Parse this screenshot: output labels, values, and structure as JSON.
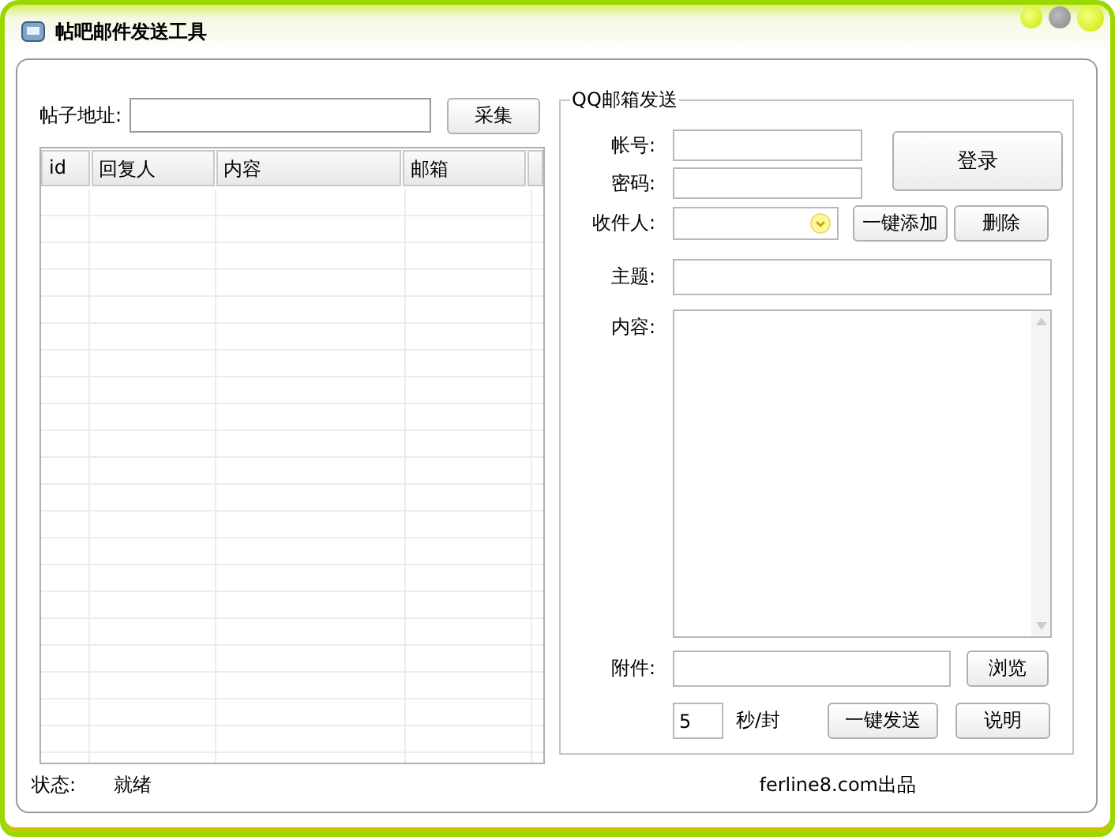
{
  "window": {
    "title": "帖吧邮件发送工具"
  },
  "left": {
    "url_label": "帖子地址:",
    "collect_button": "采集"
  },
  "table": {
    "columns": [
      "id",
      "回复人",
      "内容",
      "邮箱"
    ]
  },
  "send_group": {
    "title": "QQ邮箱发送",
    "account_label": "帐号:",
    "password_label": "密码:",
    "login_button": "登录",
    "recipient_label": "收件人:",
    "add_all_button": "一键添加",
    "delete_button": "删除",
    "subject_label": "主题:",
    "content_label": "内容:",
    "attachment_label": "附件:",
    "browse_button": "浏览",
    "interval_value": "5",
    "interval_unit": "秒/封",
    "send_all_button": "一键发送",
    "help_button": "说明"
  },
  "status_bar": {
    "label": "状态:",
    "status": "就绪",
    "credit": "ferline8.com出品"
  }
}
